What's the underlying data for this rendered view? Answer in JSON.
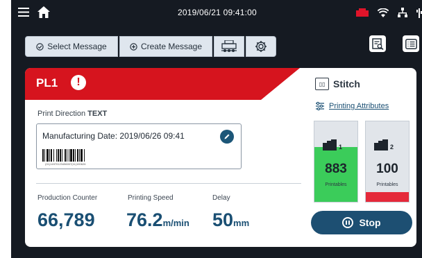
{
  "status_bar": {
    "datetime": "2019/06/21 09:41:00",
    "icons": [
      "menu-icon",
      "home-icon",
      "printer-status-icon",
      "wifi-icon",
      "network-icon",
      "usb-icon"
    ],
    "status_color": "#e0142a"
  },
  "toolbar": {
    "select_message_label": "Select Message",
    "create_message_label": "Create Message",
    "icons": [
      "printer-queue-icon",
      "settings-gear-icon",
      "message-preview-icon",
      "list-menu-icon"
    ]
  },
  "printer": {
    "name": "PL1",
    "alert": "!",
    "header_color": "#d6141e",
    "print_direction_label": "Print Direction",
    "print_direction_value": "TEXT",
    "message_text": "Manufacturing Date: 2019/06/26 09:41",
    "barcode_text": "(01)14970123456007(11)190626",
    "stats": [
      {
        "label": "Production Counter",
        "value": "66,789",
        "unit": ""
      },
      {
        "label": "Printing Speed",
        "value": "76.2",
        "unit": "m/min"
      },
      {
        "label": "Delay",
        "value": "50",
        "unit": "mm"
      }
    ]
  },
  "side_panel": {
    "stitch_label": "Stitch",
    "attributes_link": "Printing Attributes",
    "cartridges": [
      {
        "number": "1",
        "count": "883",
        "sub": "Printables",
        "level": 0.68,
        "color": "#3bcc5a"
      },
      {
        "number": "2",
        "count": "100",
        "sub": "Printables",
        "level": 0.12,
        "color": "#e5293a"
      }
    ],
    "stop_label": "Stop"
  }
}
